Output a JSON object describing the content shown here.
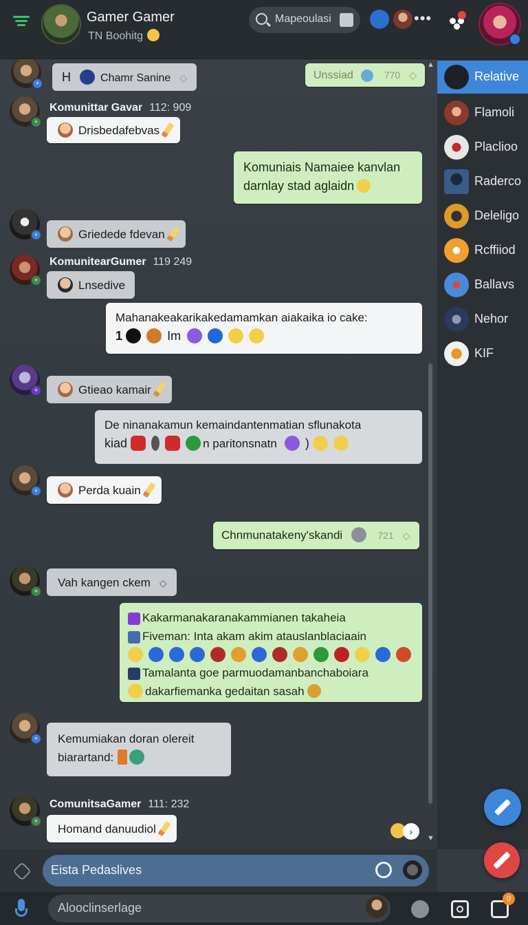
{
  "header": {
    "title": "Gamer Gamer",
    "subtitle": "TN Boohitg",
    "search_placeholder": "Mapeoulasi",
    "more": "•••"
  },
  "messages": [
    {
      "id": "m1",
      "kind": "incoming-grey",
      "prefix": "H",
      "text": "Chamr Sanine",
      "check": "◇"
    },
    {
      "id": "m2",
      "kind": "outgoing-top",
      "text": "Unssiad",
      "time": "770",
      "check": "◇"
    },
    {
      "id": "m3",
      "kind": "incoming",
      "sender": "Komunittar Gavar",
      "time": "112: 909",
      "text": "Drisbedafebvas"
    },
    {
      "id": "m4",
      "kind": "outgoing",
      "lines": [
        "Komuniais Namaiee kanvlan",
        "darnlay stad aglaidn"
      ]
    },
    {
      "id": "m5",
      "kind": "incoming",
      "text": "Griedede fdevan"
    },
    {
      "id": "m6",
      "kind": "incoming-grey",
      "sender": "KomunitearGumer",
      "time": "119 249",
      "text": "Lnsedive"
    },
    {
      "id": "m7",
      "kind": "incoming",
      "lines": [
        "Mahanakeakarikakedamamkan aiakaika io cake:",
        "Im"
      ],
      "lead": "1"
    },
    {
      "id": "m8",
      "kind": "incoming",
      "text": "Gtieao kamair"
    },
    {
      "id": "m9",
      "kind": "incoming-grey",
      "lines": [
        "De ninanakamun kemaindantenmatian sflunakota",
        "kiad",
        "n paritonsnatn",
        ")"
      ]
    },
    {
      "id": "m10",
      "kind": "incoming",
      "text": "Perda kuain"
    },
    {
      "id": "m11",
      "kind": "outgoing",
      "text": "Chnmunatakeny'skandi",
      "time": "721",
      "check": "◇"
    },
    {
      "id": "m12",
      "kind": "incoming-grey",
      "text": "Vah kangen ckem",
      "check": "◇"
    },
    {
      "id": "m13",
      "kind": "outgoing",
      "lines": [
        "Kakarmanakaranakammianen takaheia",
        "Fiveman: Inta akam akim atauslanblaciaain",
        "Tamalanta goe parmuodamanbanchaboiara",
        "dakarfiemanka gedaitan sasah"
      ]
    },
    {
      "id": "m14",
      "kind": "incoming-grey",
      "lines": [
        "Kemumiakan doran olereit",
        "biarartand:"
      ]
    },
    {
      "id": "m15",
      "kind": "incoming",
      "sender": "ComunitsaGamer",
      "time": "111: 232",
      "text": "Homand danuudiol"
    }
  ],
  "sidebar": {
    "items": [
      {
        "label": "Relative",
        "active": true,
        "color": "#1d2127"
      },
      {
        "label": "Flamoli",
        "color": "#8a3a2a"
      },
      {
        "label": "Placlioo",
        "color": "#e6e6e6"
      },
      {
        "label": "Raderco",
        "color": "#1d3a5a"
      },
      {
        "label": "Deleligo",
        "color": "#e09a2a"
      },
      {
        "label": "Rcffiiod",
        "color": "#f0a030"
      },
      {
        "label": "Ballavs",
        "color": "#4a8ad8"
      },
      {
        "label": "Nehor",
        "color": "#2a3a5a"
      },
      {
        "label": "KIF",
        "color": "#f0f0f0"
      }
    ]
  },
  "composer": {
    "placeholder": "Eista Pedaslives"
  },
  "bottom": {
    "placeholder": "Alooclinserlage",
    "badge": "0"
  },
  "colors": {
    "accent": "#3d86d8",
    "outgoing_bubble": "#cfeec0",
    "incoming_bubble": "#f4f5f6",
    "fab_blue": "#3d86d8",
    "fab_red": "#e04646"
  },
  "icons": [
    "menu-icon",
    "search-icon",
    "more-icon",
    "notification-icon",
    "pencil-icon",
    "send-icon",
    "mic-icon",
    "camera-icon",
    "gamepad-icon",
    "sticker-icon"
  ]
}
